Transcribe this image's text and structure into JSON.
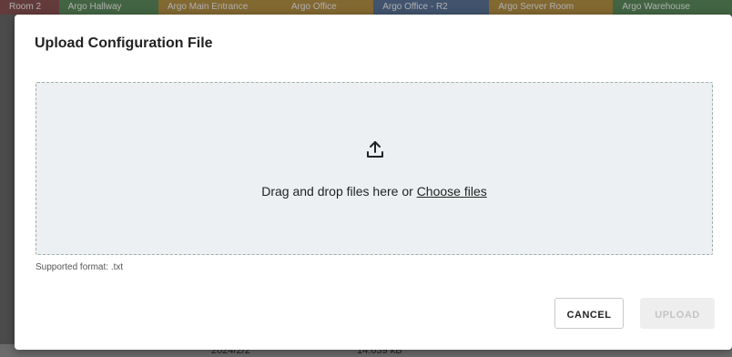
{
  "background": {
    "tabs": [
      {
        "label": "Room 2",
        "color": "#7a2e2e"
      },
      {
        "label": "Argo Hallway",
        "color": "#3c7a3c"
      },
      {
        "label": "Argo Main Entrance",
        "color": "#b0801c"
      },
      {
        "label": "Argo Office",
        "color": "#b0801c"
      },
      {
        "label": "Argo Office - R2",
        "color": "#3a5a8a"
      },
      {
        "label": "Argo Server Room",
        "color": "#b0801c"
      },
      {
        "label": "Argo Warehouse",
        "color": "#3c7a3c"
      }
    ],
    "row_date": "2024/2/2",
    "row_size": "14.639 kB"
  },
  "modal": {
    "title": "Upload Configuration File",
    "dropzone": {
      "icon": "upload-icon",
      "text": "Drag and drop files here or ",
      "link": "Choose files"
    },
    "supported_format": "Supported format: .txt",
    "buttons": {
      "cancel": "CANCEL",
      "upload": "UPLOAD"
    }
  }
}
